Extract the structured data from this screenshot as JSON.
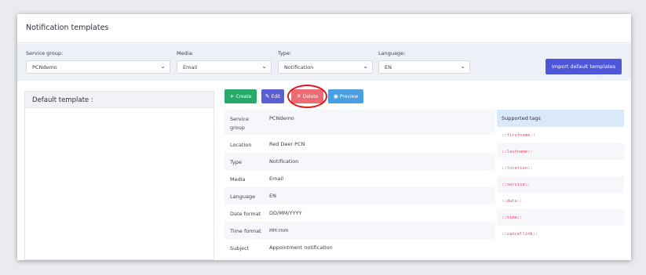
{
  "page": {
    "title": "Notification templates"
  },
  "filters": {
    "service_group": {
      "label": "Service group:",
      "value": "PCNdemo"
    },
    "media": {
      "label": "Media:",
      "value": "Email"
    },
    "type": {
      "label": "Type:",
      "value": "Notification"
    },
    "language": {
      "label": "Language:",
      "value": "EN"
    },
    "import_button": "Import default templates"
  },
  "left_panel": {
    "title": "Default template :"
  },
  "actions": {
    "create": "Create",
    "edit": "Edit",
    "delete": "Delete",
    "preview": "Preview"
  },
  "details": [
    {
      "key": "Service group",
      "value": "PCNdemo"
    },
    {
      "key": "Location",
      "value": "Red Deer PCN"
    },
    {
      "key": "Type",
      "value": "Notification"
    },
    {
      "key": "Media",
      "value": "Email"
    },
    {
      "key": "Language",
      "value": "EN"
    },
    {
      "key": "Date format",
      "value": "DD/MM/YYYY"
    },
    {
      "key": "Time format",
      "value": "HH:mm"
    },
    {
      "key": "Subject",
      "value": "Appointment notification"
    }
  ],
  "supported_tags": {
    "title": "Supported tags",
    "items": [
      "::firstname::",
      "::lastname::",
      "::location::",
      "::service::",
      "::date::",
      "::time::",
      "::cancellink::"
    ]
  },
  "colors": {
    "create": "#26a96b",
    "edit": "#5a5fd6",
    "delete": "#ef6b73",
    "preview": "#4a9fe3",
    "import": "#4f57d9",
    "highlight": "#e3131d",
    "tag_text": "#e2486b"
  }
}
